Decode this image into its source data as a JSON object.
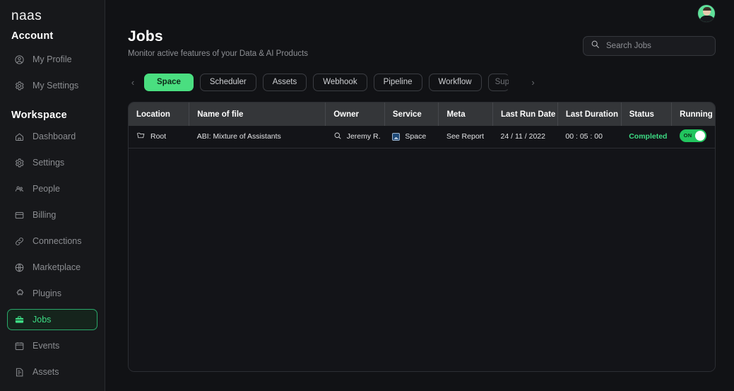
{
  "brand": {
    "logo": "naas"
  },
  "sidebar": {
    "sections": [
      {
        "title": "Account",
        "items": [
          {
            "label": "My Profile",
            "icon": "user-circle-icon",
            "active": false
          },
          {
            "label": "My Settings",
            "icon": "gear-icon",
            "active": false
          }
        ]
      },
      {
        "title": "Workspace",
        "items": [
          {
            "label": "Dashboard",
            "icon": "home-icon",
            "active": false
          },
          {
            "label": "Settings",
            "icon": "gear-icon",
            "active": false
          },
          {
            "label": "People",
            "icon": "people-icon",
            "active": false
          },
          {
            "label": "Billing",
            "icon": "credit-card-icon",
            "active": false
          },
          {
            "label": "Connections",
            "icon": "link-icon",
            "active": false
          },
          {
            "label": "Marketplace",
            "icon": "globe-icon",
            "active": false
          },
          {
            "label": "Plugins",
            "icon": "puzzle-icon",
            "active": false
          },
          {
            "label": "Jobs",
            "icon": "briefcase-icon",
            "active": true
          },
          {
            "label": "Events",
            "icon": "calendar-icon",
            "active": false
          },
          {
            "label": "Assets",
            "icon": "document-icon",
            "active": false
          }
        ]
      }
    ]
  },
  "header": {
    "title": "Jobs",
    "subtitle": "Monitor active features of your Data & AI Products",
    "avatar_name": "user-avatar"
  },
  "search": {
    "placeholder": "Search Jobs",
    "icon": "search-icon"
  },
  "filters": {
    "prev_icon": "chevron-left-icon",
    "next_icon": "chevron-right-icon",
    "chips": [
      {
        "label": "Space",
        "active": true,
        "clipped": false
      },
      {
        "label": "Scheduler",
        "active": false,
        "clipped": false
      },
      {
        "label": "Assets",
        "active": false,
        "clipped": false
      },
      {
        "label": "Webhook",
        "active": false,
        "clipped": false
      },
      {
        "label": "Pipeline",
        "active": false,
        "clipped": false
      },
      {
        "label": "Workflow",
        "active": false,
        "clipped": false
      },
      {
        "label": "Sup",
        "active": false,
        "clipped": true
      }
    ]
  },
  "table": {
    "columns": [
      "Location",
      "Name of file",
      "Owner",
      "Service",
      "Meta",
      "Last Run Date",
      "Last Duration",
      "Status",
      "Running"
    ],
    "rows": [
      {
        "location": "Root",
        "location_icon": "folder-icon",
        "name_of_file": "ABI: Mixture of Assistants",
        "owner": "Jeremy R.",
        "owner_icon": "search-icon",
        "service": "Space",
        "service_icon": "image-icon",
        "meta": "See Report",
        "last_run_date": "24 / 11 / 2022",
        "last_duration": "00 : 05 : 00",
        "status": "Completed",
        "running_label": "ON",
        "running_on": true
      }
    ]
  },
  "colors": {
    "accent_green": "#4ade80",
    "status_green": "#3ddc84",
    "page_bg": "#111215",
    "sidebar_bg": "#17181b",
    "table_header_bg": "#343639"
  }
}
